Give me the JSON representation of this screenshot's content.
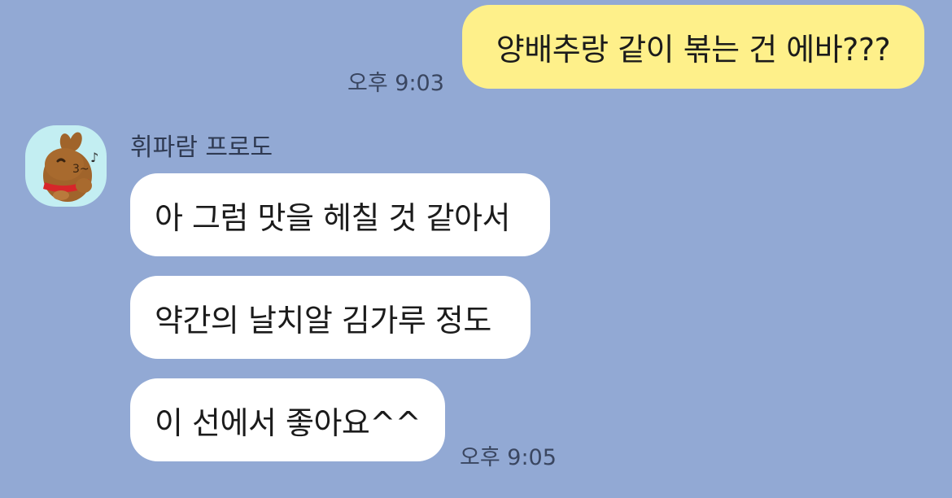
{
  "chat": {
    "outgoing": {
      "text": "양배추랑 같이 볶는 건 에바???",
      "time": "오후 9:03"
    },
    "incoming": {
      "sender": "휘파람 프로도",
      "avatar_icon": "frodo-character-icon",
      "messages": [
        "아 그럼 맛을 헤칠 것 같아서",
        "약간의 날치알 김가루 정도",
        "이 선에서 좋아요^^"
      ],
      "time": "오후 9:05"
    }
  },
  "colors": {
    "background": "#92A9D4",
    "outgoing_bubble": "#FEF08A",
    "incoming_bubble": "#FFFFFF",
    "avatar_bg": "#C3EEF2"
  }
}
